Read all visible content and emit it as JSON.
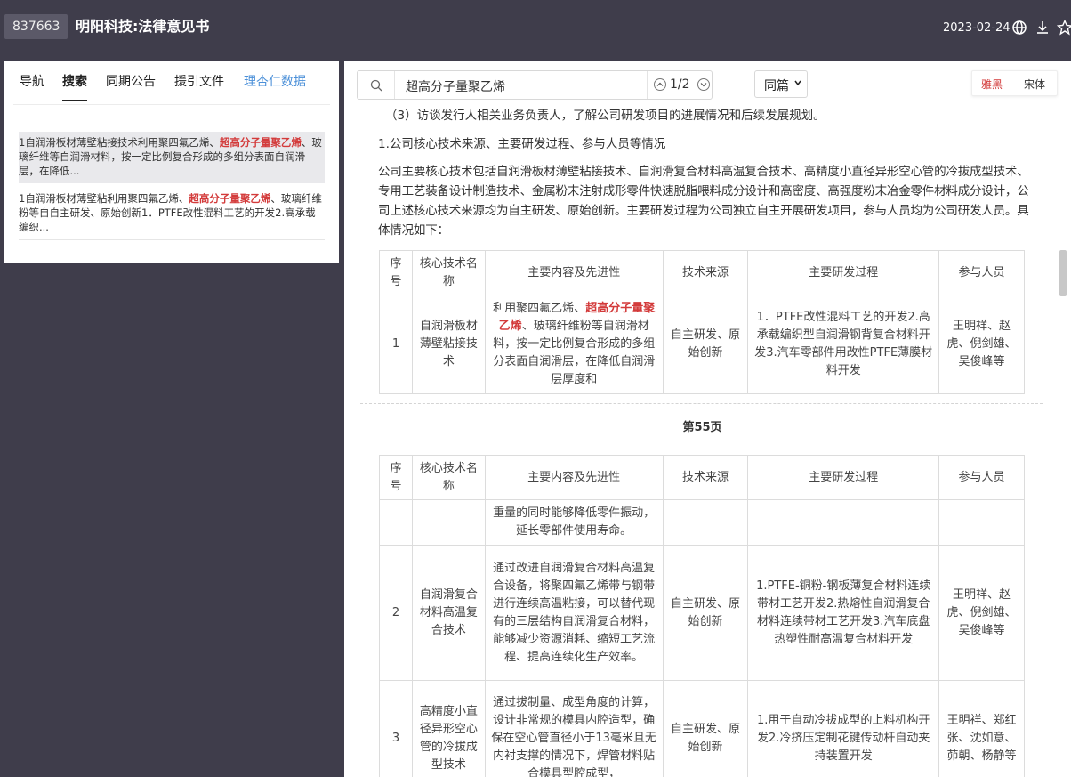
{
  "header": {
    "code": "837663",
    "title": "明阳科技:法律意见书",
    "date": "2023-02-24"
  },
  "left_tabs": [
    "导航",
    "搜索",
    "同期公告",
    "援引文件",
    "理杏仁数据"
  ],
  "search_results": [
    {
      "pre": "1自润滑板材薄壁粘接技术利用聚四氟乙烯、",
      "kw": "超高分子量聚乙烯",
      "post": "、玻璃纤维等自润滑材料，按一定比例复合形成的多组分表面自润滑层，在降低..."
    },
    {
      "pre": "1自润滑板材薄壁粘利用聚四氟乙烯、",
      "kw": "超高分子量聚乙烯",
      "post": "、玻璃纤维粉等自自主研发、原始创新1．PTFE改性混料工艺的开发2.高承载编织..."
    }
  ],
  "toolbar": {
    "search_value": "超高分子量聚乙烯",
    "match_count": "1/2",
    "scope": "同篇",
    "font_a": "雅黑",
    "font_b": "宋体"
  },
  "doc": {
    "para1": "（3）访谈发行人相关业务负责人，了解公司研发项目的进展情况和后续发展规划。",
    "heading1": "1.公司核心技术来源、主要研发过程、参与人员等情况",
    "para2": "公司主要核心技术包括自润滑板材薄壁粘接技术、自润滑复合材料高温复合技术、高精度小直径异形空心管的冷拔成型技术、专用工艺装备设计制造技术、金属粉末注射成形零件快速脱脂喂料成分设计和高密度、高强度粉末冶金零件材料成分设计，公司上述核心技术来源均为自主研发、原始创新。主要研发过程为公司独立自主开展研发项目，参与人员均为公司研发人员。具体情况如下：",
    "headers": [
      "序号",
      "核心技术名称",
      "主要内容及先进性",
      "技术来源",
      "主要研发过程",
      "参与人员"
    ],
    "row1": {
      "no": "1",
      "name": "自润滑板材薄壁粘接技术",
      "content_pre": "利用聚四氟乙烯、",
      "content_kw": "超高分子量聚乙烯",
      "content_post": "、玻璃纤维粉等自润滑材料，按一定比例复合形成的多组分表面自润滑层，在降低自润滑层厚度和",
      "source": "自主研发、原始创新",
      "process": "1．PTFE改性混料工艺的开发2.高承载编织型自润滑钢背复合材料开发3.汽车零部件用改性PTFE薄膜材料开发",
      "people": "王明祥、赵虎、倪剑雄、吴俊峰等"
    },
    "page_label": "第55页",
    "cont_content": "重量的同时能够降低零件振动，延长零部件使用寿命。",
    "row2": {
      "no": "2",
      "name": "自润滑复合材料高温复合技术",
      "content": "通过改进自润滑复合材料高温复合设备，将聚四氟乙烯带与钢带进行连续高温粘接，可以替代现有的三层结构自润滑复合材料，能够减少资源消耗、缩短工艺流程、提高连续化生产效率。",
      "source": "自主研发、原始创新",
      "process": "1.PTFE-铜粉-钢板薄复合材料连续带材工艺开发2.热熔性自润滑复合材料连续带材工艺开发3.汽车底盘热塑性耐高温复合材料开发",
      "people": "王明祥、赵虎、倪剑雄、吴俊峰等"
    },
    "row3": {
      "no": "3",
      "name": "高精度小直径异形空心管的冷拔成型技术",
      "content": "通过拔制量、成型角度的计算，设计非常规的模具内腔造型，确保在空心管直径小于13毫米且无内衬支撑的情况下，焊管材料贴合模具型腔成型，",
      "source": "自主研发、原始创新",
      "process": "1.用于自动冷拔成型的上料机构开发2.冷挤压定制花键传动杆自动夹持装置开发",
      "people": "王明祥、郑红张、沈如意、茆朝、杨静等"
    }
  }
}
